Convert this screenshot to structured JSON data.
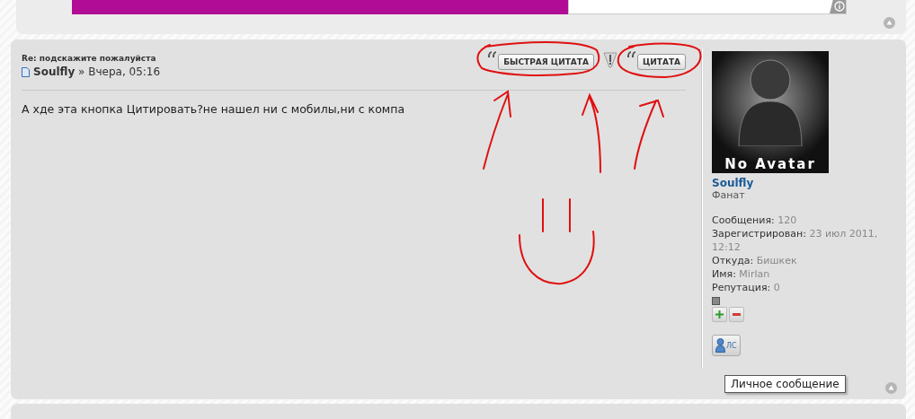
{
  "post": {
    "title": "Re: подскажите пожалуйста",
    "byline": "**Soulfly** » Вчера, 05:16",
    "buttons": [
      {
        "label": "БЫСТРАЯ ЦИТАТА",
        "kind": "quick"
      },
      {
        "label": "ЦИТАТА",
        "kind": "quote"
      }
    ],
    "message": "А хде эта кнопка Цитировать?не нашел ни с мобилы,ни с компа",
    "profile": {
      "avatar_caption": "No Avatar",
      "username": "Soulfly",
      "rank": "Фанат",
      "fields": [
        {
          "label": "Сообщения:",
          "value": "120"
        },
        {
          "label": "Зарегистрирован:",
          "value": "23 июл 2011, 12:12"
        },
        {
          "label": "Откуда:",
          "value": "Бишкек"
        },
        {
          "label": "Имя:",
          "value": "Mirlan"
        },
        {
          "label": "Репутация:",
          "value": "0"
        }
      ],
      "pm_button": "ЛС"
    }
  },
  "tooltip": "Личное сообщение"
}
